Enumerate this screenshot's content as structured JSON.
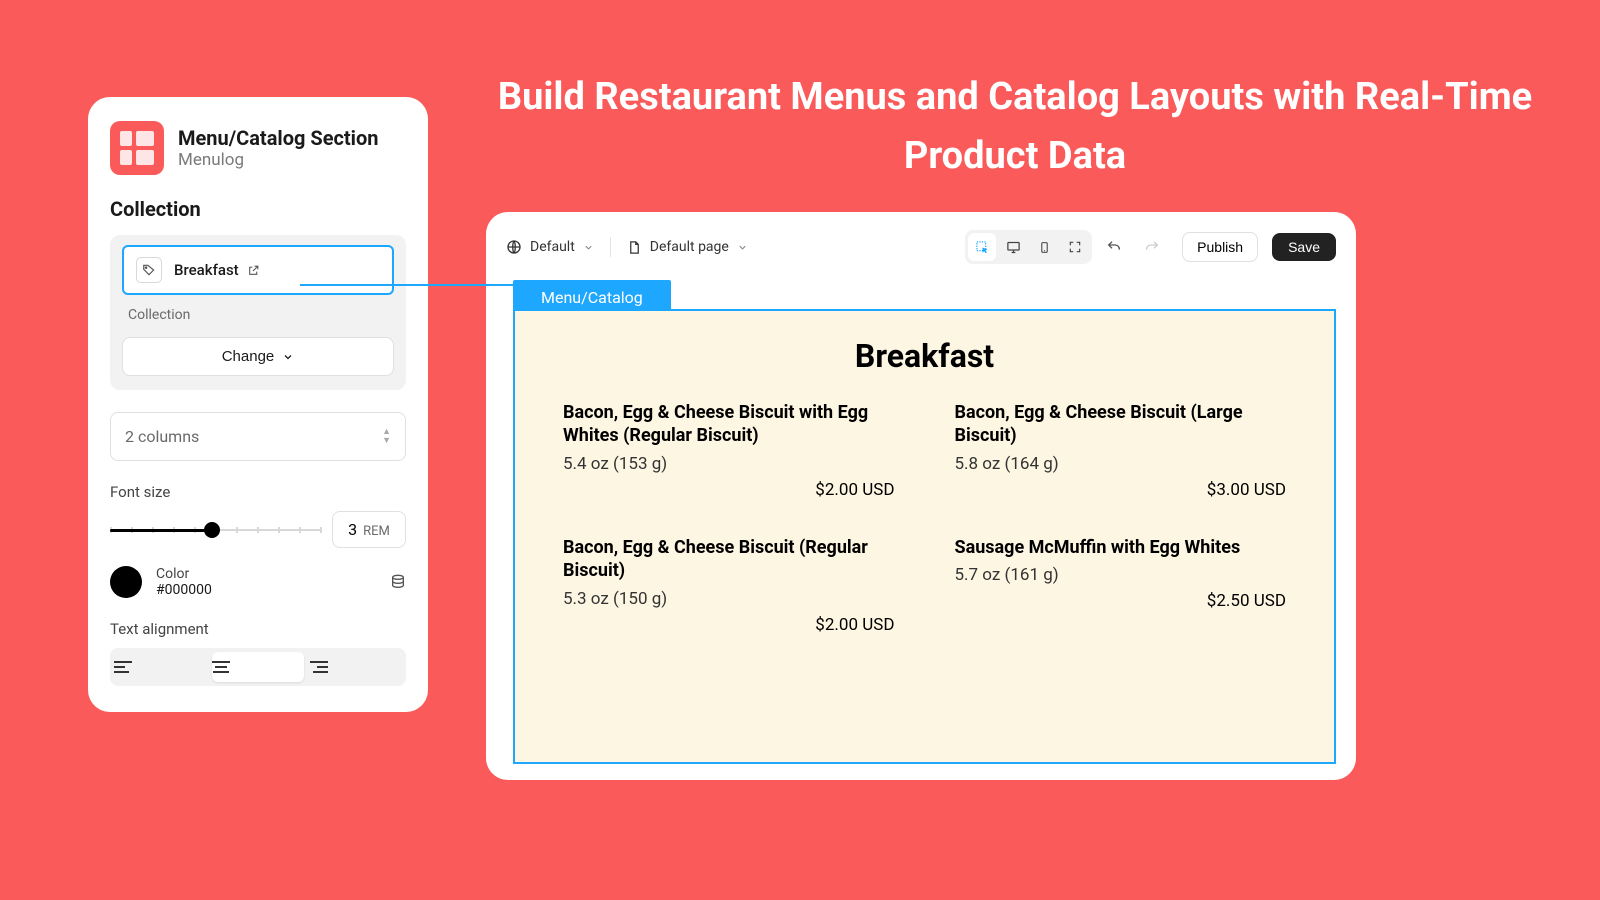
{
  "headline": "Build Restaurant Menus and Catalog Layouts with Real-Time Product Data",
  "panel": {
    "title": "Menu/Catalog Section",
    "subtitle": "Menulog",
    "section_label": "Collection",
    "collection_name": "Breakfast",
    "collection_sub": "Collection",
    "change_label": "Change",
    "columns_label": "2 columns",
    "font_size_label": "Font size",
    "font_size_value": "3",
    "font_size_unit": "REM",
    "color_label": "Color",
    "color_value": "#000000",
    "text_alignment_label": "Text alignment"
  },
  "editor": {
    "theme_label": "Default",
    "page_label": "Default page",
    "publish": "Publish",
    "save": "Save",
    "tab_label": "Menu/Catalog"
  },
  "menu": {
    "title": "Breakfast",
    "items": [
      {
        "name": "Bacon, Egg & Cheese Biscuit with Egg Whites (Regular Biscuit)",
        "meta": "5.4 oz (153 g)",
        "price": "$2.00 USD"
      },
      {
        "name": "Bacon, Egg & Cheese Biscuit (Large Biscuit)",
        "meta": "5.8 oz (164 g)",
        "price": "$3.00 USD"
      },
      {
        "name": "Bacon, Egg & Cheese Biscuit (Regular Biscuit)",
        "meta": "5.3 oz (150 g)",
        "price": "$2.00 USD"
      },
      {
        "name": "Sausage McMuffin with Egg Whites",
        "meta": "5.7 oz (161 g)",
        "price": "$2.50 USD"
      }
    ]
  }
}
